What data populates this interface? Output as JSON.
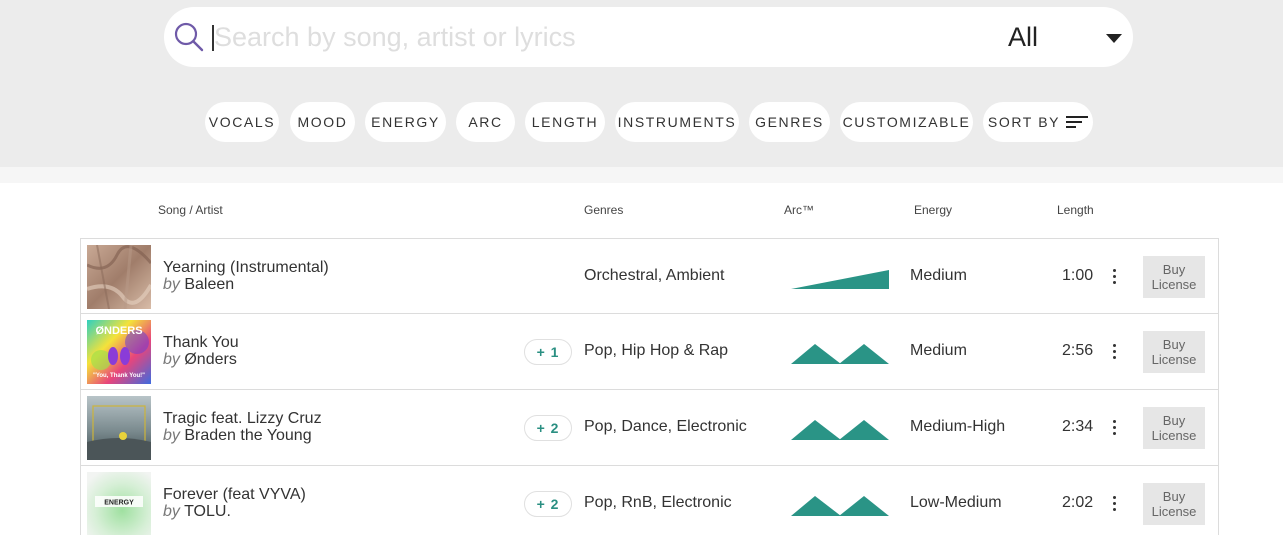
{
  "search": {
    "placeholder": "Search by song, artist or lyrics",
    "value": ""
  },
  "filter": {
    "selected": "All"
  },
  "filter_pills": [
    "VOCALS",
    "MOOD",
    "ENERGY",
    "ARC",
    "LENGTH",
    "INSTRUMENTS",
    "GENRES",
    "CUSTOMIZABLE"
  ],
  "sort_label": "SORT BY",
  "columns": {
    "song": "Song / Artist",
    "genres": "Genres",
    "arc": "Arc™",
    "energy": "Energy",
    "length": "Length"
  },
  "rows": [
    {
      "title": "Yearning (Instrumental)",
      "by": "by",
      "artist": "Baleen",
      "extra_genres": "",
      "genres": "Orchestral, Ambient",
      "arc": "rising",
      "energy": "Medium",
      "length": "1:00",
      "buy": "Buy License"
    },
    {
      "title": "Thank You",
      "by": "by",
      "artist": "Ønders",
      "extra_genres": "+ 1",
      "genres": "Pop, Hip Hop & Rap",
      "arc": "double-peak",
      "energy": "Medium",
      "length": "2:56",
      "buy": "Buy License"
    },
    {
      "title": "Tragic feat. Lizzy Cruz",
      "by": "by",
      "artist": "Braden the Young",
      "extra_genres": "+ 2",
      "genres": "Pop, Dance, Electronic",
      "arc": "double-peak",
      "energy": "Medium-High",
      "length": "2:34",
      "buy": "Buy License"
    },
    {
      "title": "Forever (feat VYVA)",
      "by": "by",
      "artist": "TOLU.",
      "extra_genres": "+ 2",
      "genres": "Pop, RnB, Electronic",
      "arc": "double-peak",
      "energy": "Low-Medium",
      "length": "2:02",
      "buy": "Buy License"
    }
  ],
  "thumbs": {
    "row2_text_top": "ØNDERS",
    "row2_text_bottom": "\"You, Thank You!\"",
    "row4_text": "ENERGY"
  },
  "colors": {
    "accent": "#2a9486",
    "search_icon": "#6f5aa8",
    "header_bg": "#ececec"
  }
}
